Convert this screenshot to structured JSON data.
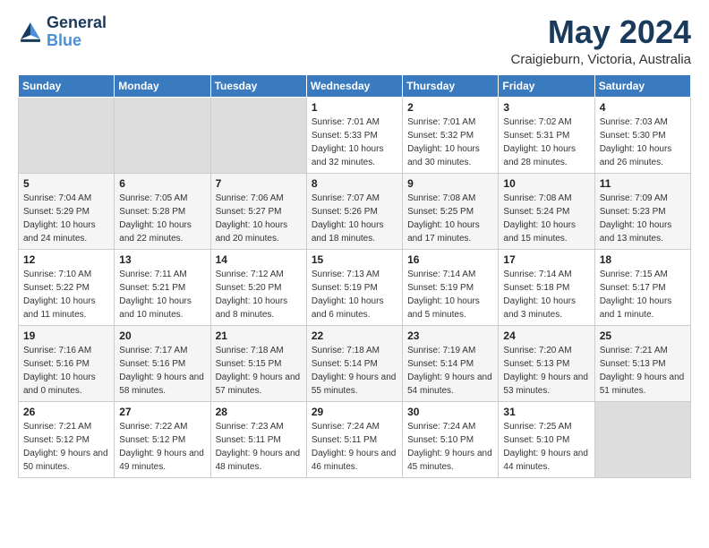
{
  "logo": {
    "line1": "General",
    "line2": "Blue"
  },
  "title": "May 2024",
  "location": "Craigieburn, Victoria, Australia",
  "weekdays": [
    "Sunday",
    "Monday",
    "Tuesday",
    "Wednesday",
    "Thursday",
    "Friday",
    "Saturday"
  ],
  "weeks": [
    [
      {
        "day": "",
        "empty": true
      },
      {
        "day": "",
        "empty": true
      },
      {
        "day": "",
        "empty": true
      },
      {
        "day": "1",
        "sunrise": "7:01 AM",
        "sunset": "5:33 PM",
        "daylight": "10 hours and 32 minutes."
      },
      {
        "day": "2",
        "sunrise": "7:01 AM",
        "sunset": "5:32 PM",
        "daylight": "10 hours and 30 minutes."
      },
      {
        "day": "3",
        "sunrise": "7:02 AM",
        "sunset": "5:31 PM",
        "daylight": "10 hours and 28 minutes."
      },
      {
        "day": "4",
        "sunrise": "7:03 AM",
        "sunset": "5:30 PM",
        "daylight": "10 hours and 26 minutes."
      }
    ],
    [
      {
        "day": "5",
        "sunrise": "7:04 AM",
        "sunset": "5:29 PM",
        "daylight": "10 hours and 24 minutes."
      },
      {
        "day": "6",
        "sunrise": "7:05 AM",
        "sunset": "5:28 PM",
        "daylight": "10 hours and 22 minutes."
      },
      {
        "day": "7",
        "sunrise": "7:06 AM",
        "sunset": "5:27 PM",
        "daylight": "10 hours and 20 minutes."
      },
      {
        "day": "8",
        "sunrise": "7:07 AM",
        "sunset": "5:26 PM",
        "daylight": "10 hours and 18 minutes."
      },
      {
        "day": "9",
        "sunrise": "7:08 AM",
        "sunset": "5:25 PM",
        "daylight": "10 hours and 17 minutes."
      },
      {
        "day": "10",
        "sunrise": "7:08 AM",
        "sunset": "5:24 PM",
        "daylight": "10 hours and 15 minutes."
      },
      {
        "day": "11",
        "sunrise": "7:09 AM",
        "sunset": "5:23 PM",
        "daylight": "10 hours and 13 minutes."
      }
    ],
    [
      {
        "day": "12",
        "sunrise": "7:10 AM",
        "sunset": "5:22 PM",
        "daylight": "10 hours and 11 minutes."
      },
      {
        "day": "13",
        "sunrise": "7:11 AM",
        "sunset": "5:21 PM",
        "daylight": "10 hours and 10 minutes."
      },
      {
        "day": "14",
        "sunrise": "7:12 AM",
        "sunset": "5:20 PM",
        "daylight": "10 hours and 8 minutes."
      },
      {
        "day": "15",
        "sunrise": "7:13 AM",
        "sunset": "5:19 PM",
        "daylight": "10 hours and 6 minutes."
      },
      {
        "day": "16",
        "sunrise": "7:14 AM",
        "sunset": "5:19 PM",
        "daylight": "10 hours and 5 minutes."
      },
      {
        "day": "17",
        "sunrise": "7:14 AM",
        "sunset": "5:18 PM",
        "daylight": "10 hours and 3 minutes."
      },
      {
        "day": "18",
        "sunrise": "7:15 AM",
        "sunset": "5:17 PM",
        "daylight": "10 hours and 1 minute."
      }
    ],
    [
      {
        "day": "19",
        "sunrise": "7:16 AM",
        "sunset": "5:16 PM",
        "daylight": "10 hours and 0 minutes."
      },
      {
        "day": "20",
        "sunrise": "7:17 AM",
        "sunset": "5:16 PM",
        "daylight": "9 hours and 58 minutes."
      },
      {
        "day": "21",
        "sunrise": "7:18 AM",
        "sunset": "5:15 PM",
        "daylight": "9 hours and 57 minutes."
      },
      {
        "day": "22",
        "sunrise": "7:18 AM",
        "sunset": "5:14 PM",
        "daylight": "9 hours and 55 minutes."
      },
      {
        "day": "23",
        "sunrise": "7:19 AM",
        "sunset": "5:14 PM",
        "daylight": "9 hours and 54 minutes."
      },
      {
        "day": "24",
        "sunrise": "7:20 AM",
        "sunset": "5:13 PM",
        "daylight": "9 hours and 53 minutes."
      },
      {
        "day": "25",
        "sunrise": "7:21 AM",
        "sunset": "5:13 PM",
        "daylight": "9 hours and 51 minutes."
      }
    ],
    [
      {
        "day": "26",
        "sunrise": "7:21 AM",
        "sunset": "5:12 PM",
        "daylight": "9 hours and 50 minutes."
      },
      {
        "day": "27",
        "sunrise": "7:22 AM",
        "sunset": "5:12 PM",
        "daylight": "9 hours and 49 minutes."
      },
      {
        "day": "28",
        "sunrise": "7:23 AM",
        "sunset": "5:11 PM",
        "daylight": "9 hours and 48 minutes."
      },
      {
        "day": "29",
        "sunrise": "7:24 AM",
        "sunset": "5:11 PM",
        "daylight": "9 hours and 46 minutes."
      },
      {
        "day": "30",
        "sunrise": "7:24 AM",
        "sunset": "5:10 PM",
        "daylight": "9 hours and 45 minutes."
      },
      {
        "day": "31",
        "sunrise": "7:25 AM",
        "sunset": "5:10 PM",
        "daylight": "9 hours and 44 minutes."
      },
      {
        "day": "",
        "empty": true
      }
    ]
  ],
  "labels": {
    "sunrise": "Sunrise:",
    "sunset": "Sunset:",
    "daylight": "Daylight:"
  }
}
